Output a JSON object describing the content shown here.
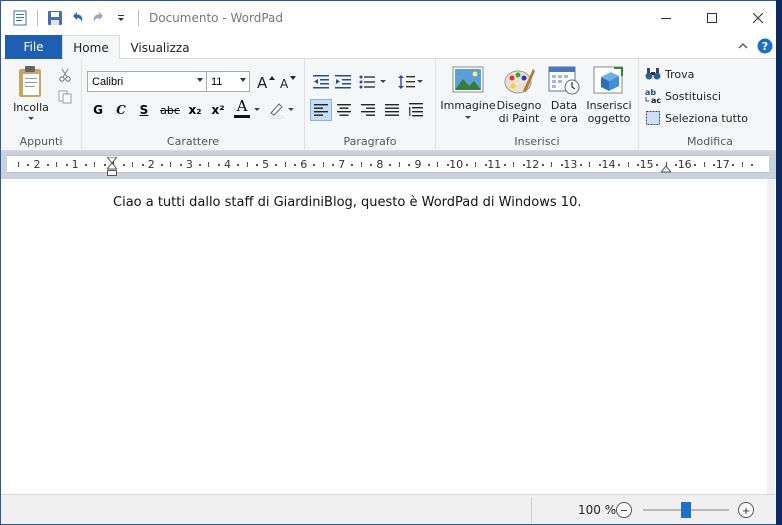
{
  "window": {
    "title": "Documento - WordPad",
    "accent": "#1e5fb3"
  },
  "qat": {
    "icons": [
      "wordpad-app-icon",
      "save-icon",
      "undo-icon",
      "redo-icon",
      "customize-qat-icon"
    ]
  },
  "tabs": {
    "file": "File",
    "home": "Home",
    "view": "Visualizza"
  },
  "ribbon": {
    "clipboard": {
      "label": "Appunti",
      "paste": "Incolla"
    },
    "font": {
      "label": "Carattere",
      "family": "Calibri",
      "size": "11",
      "bold": "G",
      "italic": "C",
      "underline": "S",
      "strike": "abc",
      "subscript": "x₂",
      "superscript": "x²",
      "color": "A"
    },
    "paragraph": {
      "label": "Paragrafo"
    },
    "insert": {
      "label": "Inserisci",
      "image": "Immagine",
      "paint_line1": "Disegno",
      "paint_line2": "di Paint",
      "datetime_line1": "Data",
      "datetime_line2": "e ora",
      "object_line1": "Inserisci",
      "object_line2": "oggetto"
    },
    "edit": {
      "label": "Modifica",
      "find": "Trova",
      "replace": "Sostituisci",
      "select_all": "Seleziona tutto"
    }
  },
  "ruler": {
    "numbers": [
      "2",
      "1",
      "1",
      "2",
      "3",
      "4",
      "5",
      "6",
      "7",
      "8",
      "9",
      "10",
      "11",
      "12",
      "13",
      "14",
      "15",
      "16",
      "17"
    ]
  },
  "document": {
    "text": "Ciao a tutti dallo staff di GiardiniBlog, questo è WordPad di Windows 10."
  },
  "status": {
    "zoom": "100 %",
    "zoom_minus": "−",
    "zoom_plus": "+",
    "zoom_level": 0.5
  }
}
